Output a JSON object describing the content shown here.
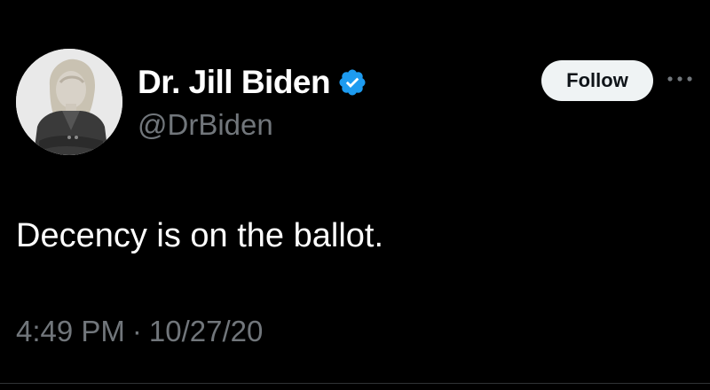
{
  "author": {
    "display_name": "Dr. Jill Biden",
    "handle": "@DrBiden",
    "verified": true,
    "verified_color": "#1d9bf0"
  },
  "actions": {
    "follow_label": "Follow",
    "more_icon": "more-horizontal-icon"
  },
  "tweet": {
    "text": "Decency is on the ballot.",
    "time": "4:49 PM",
    "separator": "·",
    "date": "10/27/20"
  },
  "colors": {
    "background": "#000000",
    "primary_text": "#ffffff",
    "secondary_text": "#71767b",
    "follow_button_bg": "#eff3f4",
    "follow_button_text": "#0f1419"
  }
}
